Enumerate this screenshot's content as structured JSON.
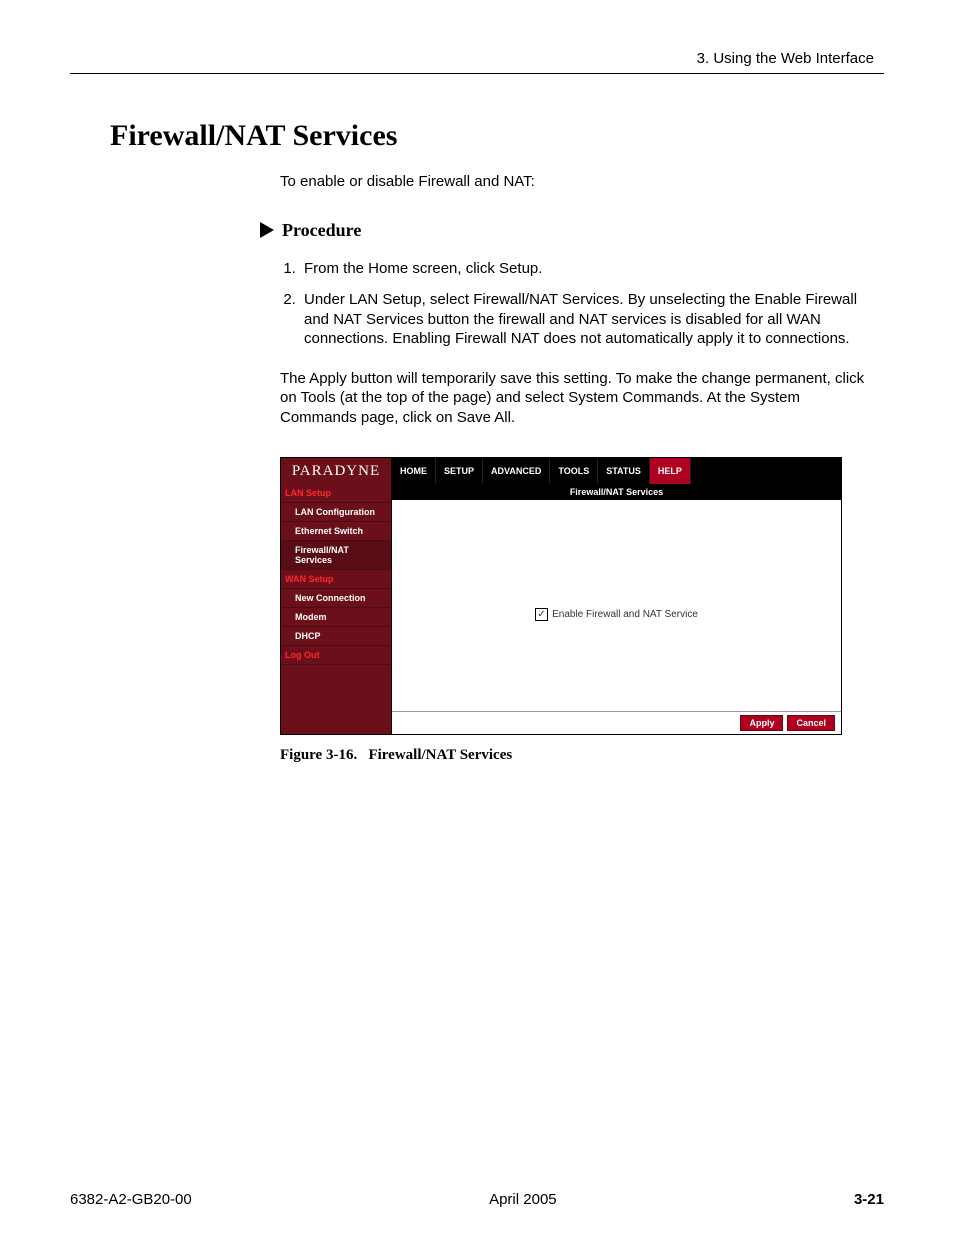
{
  "header": {
    "right": "3. Using the Web Interface"
  },
  "title": "Firewall/NAT Services",
  "intro": "To enable or disable Firewall and NAT:",
  "procedure_label": "Procedure",
  "steps": [
    "From the Home screen, click Setup.",
    "Under LAN Setup, select Firewall/NAT Services. By unselecting the Enable Firewall and NAT Services button the firewall and NAT services is disabled for all WAN connections.  Enabling Firewall NAT does not automatically apply it to connections."
  ],
  "note": "The Apply button will temporarily save this setting. To make the change permanent, click on Tools (at the top of the page) and select System Commands. At the System Commands page, click on Save All.",
  "shot": {
    "brand": "PARADYNE",
    "tabs": [
      "HOME",
      "SETUP",
      "ADVANCED",
      "TOOLS",
      "STATUS",
      "HELP"
    ],
    "sidebar": [
      {
        "label": "LAN Setup",
        "type": "header"
      },
      {
        "label": "LAN Configuration",
        "type": "sub"
      },
      {
        "label": "Ethernet Switch",
        "type": "sub"
      },
      {
        "label": "Firewall/NAT Services",
        "type": "sub-active"
      },
      {
        "label": "WAN Setup",
        "type": "header"
      },
      {
        "label": "New Connection",
        "type": "sub"
      },
      {
        "label": "Modem",
        "type": "sub"
      },
      {
        "label": "DHCP",
        "type": "sub"
      },
      {
        "label": "Log Out",
        "type": "header"
      }
    ],
    "pane_title": "Firewall/NAT Services",
    "checkbox_label": "Enable Firewall and NAT Service",
    "checkbox_checked": "✓",
    "buttons": {
      "apply": "Apply",
      "cancel": "Cancel"
    }
  },
  "caption_prefix": "Figure 3-16.",
  "caption_text": "Firewall/NAT Services",
  "footer": {
    "left": "6382-A2-GB20-00",
    "center": "April 2005",
    "right": "3-21"
  }
}
